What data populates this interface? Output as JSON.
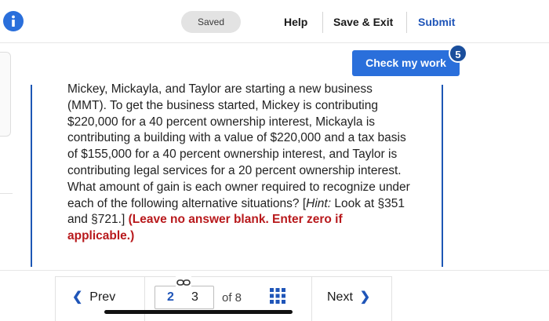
{
  "topbar": {
    "saved_label": "Saved",
    "help_label": "Help",
    "save_exit_label": "Save & Exit",
    "submit_label": "Submit"
  },
  "check": {
    "label": "Check my work",
    "badge_count": "5"
  },
  "question": {
    "part1": "Mickey, Mickayla, and Taylor are starting a new business (MMT). To get the business started, Mickey is contributing $220,000 for a 40 percent ownership interest, Mickayla is contributing a building with a value of $220,000 and a tax basis of $155,000 for a 40 percent ownership interest, and Taylor is contributing legal services for a 20 percent ownership interest. What amount of gain is each owner required to recognize under each of the following alternative situations? [",
    "hint_label": "Hint:",
    "part2": " Look at §351 and §721.] ",
    "emphasis": "(Leave no answer blank. Enter zero if applicable.)"
  },
  "pagination": {
    "prev_label": "Prev",
    "prev_icon": "chevron-left-icon",
    "current_page": "2",
    "next_page_number": "3",
    "of_label": "of 8",
    "grid_icon": "grid-icon",
    "next_label": "Next",
    "next_icon": "chevron-right-icon"
  },
  "colors": {
    "accent": "#2a6fdb",
    "link": "#1f55b8",
    "emphasis_red": "#b8191c"
  }
}
